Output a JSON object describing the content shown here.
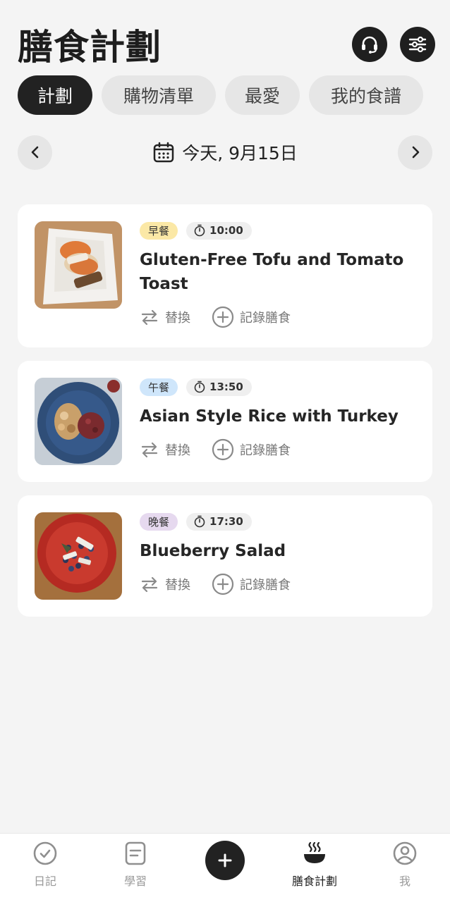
{
  "header": {
    "title": "膳食計劃",
    "support_icon": "headset-icon",
    "settings_icon": "sliders-icon"
  },
  "tabs": [
    {
      "label": "計劃",
      "active": true
    },
    {
      "label": "購物清單",
      "active": false
    },
    {
      "label": "最愛",
      "active": false
    },
    {
      "label": "我的食譜",
      "active": false
    }
  ],
  "date_nav": {
    "label": "今天, 9月15日",
    "prev_icon": "chevron-left-icon",
    "next_icon": "chevron-right-icon",
    "calendar_icon": "calendar-icon"
  },
  "meals": [
    {
      "type": "早餐",
      "time": "10:00",
      "name": "Gluten-Free Tofu and Tomato Toast",
      "badge_color": "#fbe8a6",
      "swap_label": "替換",
      "log_label": "記錄膳食"
    },
    {
      "type": "午餐",
      "time": "13:50",
      "name": "Asian Style Rice with Turkey",
      "badge_color": "#cfe6fb",
      "swap_label": "替換",
      "log_label": "記錄膳食"
    },
    {
      "type": "晚餐",
      "time": "17:30",
      "name": "Blueberry Salad",
      "badge_color": "#e6d9ef",
      "swap_label": "替換",
      "log_label": "記錄膳食"
    }
  ],
  "bottom_nav": {
    "items": [
      {
        "label": "日記",
        "icon": "check-circle-icon",
        "active": false
      },
      {
        "label": "學習",
        "icon": "document-icon",
        "active": false
      },
      {
        "label": "膳食計劃",
        "icon": "bowl-icon",
        "active": true
      },
      {
        "label": "我",
        "icon": "profile-icon",
        "active": false
      }
    ],
    "add_icon": "plus-icon"
  },
  "colors": {
    "primary": "#222222",
    "background": "#f4f4f4",
    "card": "#ffffff"
  }
}
